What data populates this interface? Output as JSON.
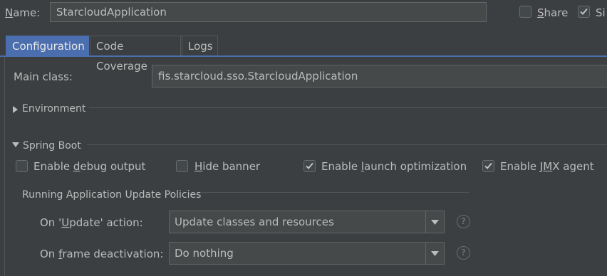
{
  "header": {
    "name_label_mnemonic": "N",
    "name_label_rest": "ame:",
    "name_value": "StarcloudApplication",
    "share_mnemonic": "S",
    "share_rest": "hare",
    "share_checked": false,
    "single_label": "Si",
    "single_checked": true
  },
  "tabs": [
    {
      "label": "Configuration",
      "active": true
    },
    {
      "label": "Code Coverage",
      "active": false
    },
    {
      "label": "Logs",
      "active": false
    }
  ],
  "main_class": {
    "label": "Main class:",
    "value": "fis.starcloud.sso.StarcloudApplication"
  },
  "environment": {
    "label": "Environment",
    "expanded": false
  },
  "spring_boot": {
    "label": "Spring Boot",
    "expanded": true,
    "options": [
      {
        "pre": "Enable ",
        "mn": "d",
        "post": "ebug output",
        "checked": false
      },
      {
        "pre": "",
        "mn": "H",
        "post": "ide banner",
        "checked": false
      },
      {
        "pre": "Enable ",
        "mn": "l",
        "post": "aunch optimization",
        "checked": true
      },
      {
        "pre": "Enable J",
        "mn": "M",
        "post": "X agent",
        "checked": true
      }
    ]
  },
  "update_policies": {
    "title": "Running Application Update Policies",
    "on_update": {
      "pre": "On '",
      "mn": "U",
      "post": "pdate' action:",
      "value": "Update classes and resources"
    },
    "on_frame": {
      "pre": "On ",
      "mn": "f",
      "post": "rame deactivation:",
      "value": "Do nothing"
    },
    "help_glyph": "?"
  },
  "icons": {
    "checkmark": "check-icon",
    "dropdown": "chevron-down-icon",
    "help": "help-icon"
  },
  "colors": {
    "accent": "#4b6eaf",
    "background": "#3c3f41",
    "text": "#bbbbbb"
  }
}
